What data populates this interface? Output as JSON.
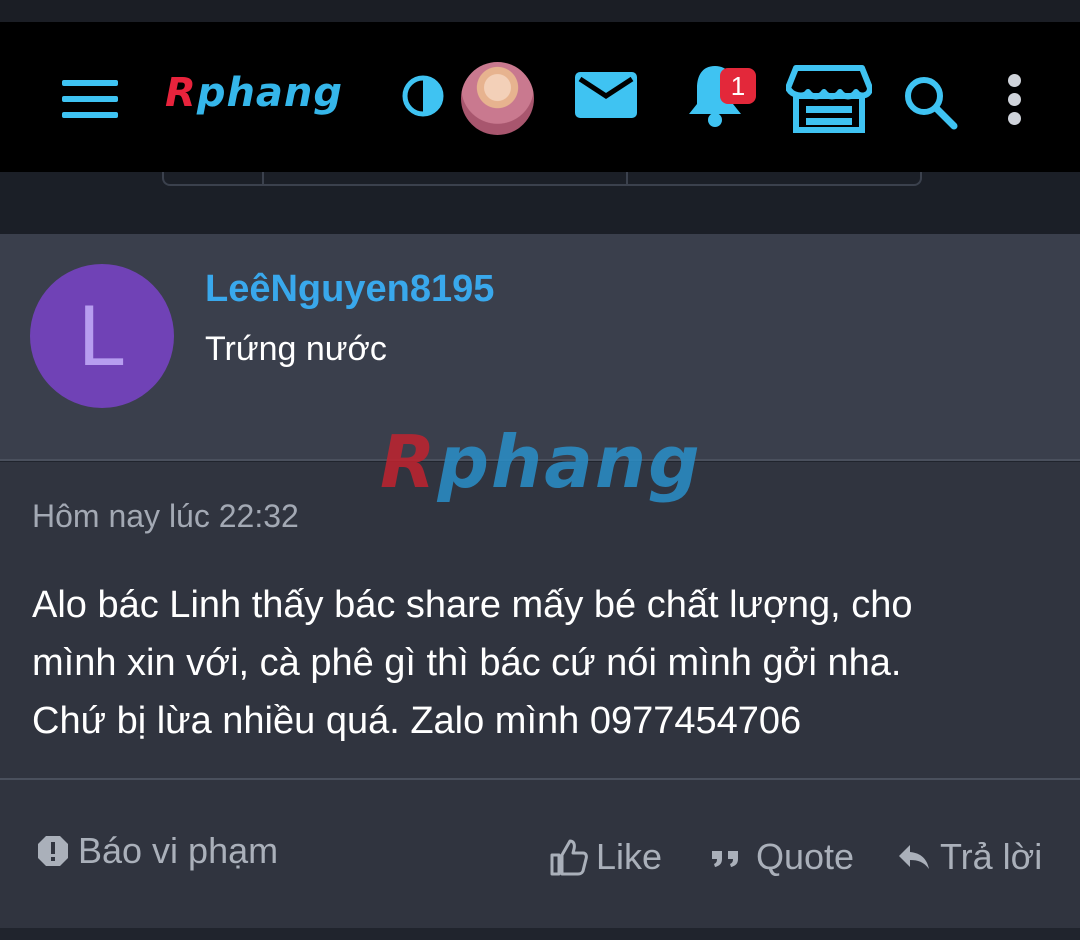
{
  "header": {
    "logo_text_r": "R",
    "logo_text_rest": "phang",
    "notification_count": "1",
    "accent_color": "#3fc3f2",
    "icons": [
      "menu-icon",
      "contrast-icon",
      "avatar",
      "mail-icon",
      "bell-icon",
      "shop-icon",
      "search-icon",
      "more-vertical-icon"
    ]
  },
  "post": {
    "avatar_letter": "L",
    "avatar_color": "#7042b6",
    "username": "LeêNguyen8195",
    "user_title": "Trứng nước",
    "watermark_r": "R",
    "watermark_rest": "phang",
    "timestamp": "Hôm nay lúc 22:32",
    "body_lines": [
      "Alo bác Linh thấy bác share mấy bé chất lượng, cho",
      "mình xin với, cà phê gì thì bác cứ nói mình gởi nha.",
      "Chứ bị lừa nhiều quá. Zalo mình 0977454706"
    ]
  },
  "actions": {
    "report": "Báo vi phạm",
    "like": "Like",
    "quote": "Quote",
    "reply": "Trả lời"
  }
}
